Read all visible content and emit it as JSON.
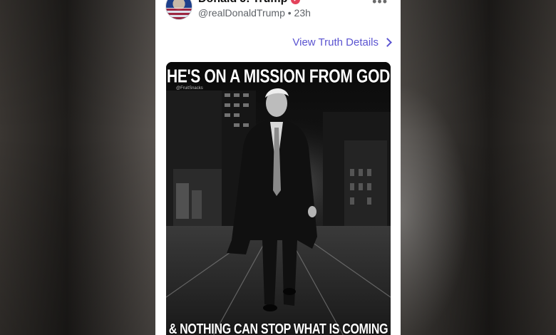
{
  "post": {
    "display_name": "Donald J. Trump",
    "handle": "@realDonaldTrump",
    "separator": "•",
    "time": "23h",
    "more_label": "•••",
    "details_link": "View Truth Details",
    "image": {
      "top_text": "HE'S ON A MISSION FROM GOD",
      "bottom_text": "& NOTHING CAN STOP WHAT IS COMING",
      "watermark": "@FruitSnacks"
    }
  },
  "colors": {
    "accent": "#5b54d1",
    "verified": "#e3425b",
    "card_bg": "#ffffff"
  },
  "icons": [
    "verified-badge-icon",
    "more-options-icon",
    "chevron-right-icon"
  ]
}
